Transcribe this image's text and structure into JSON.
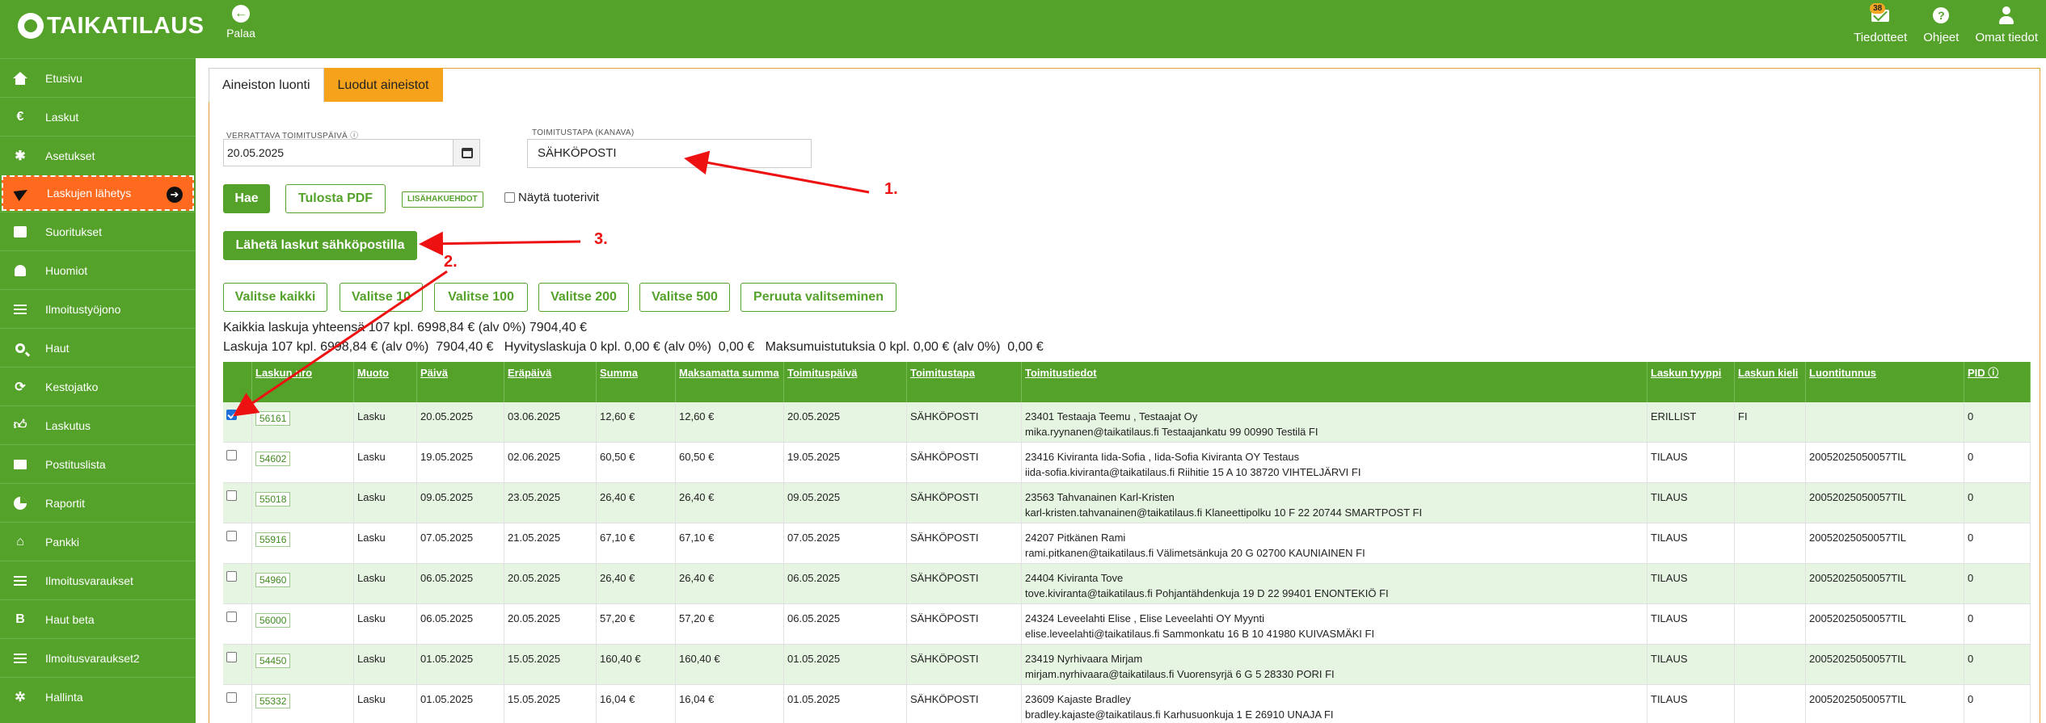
{
  "brand": {
    "logo_text": "TAIKATILAUS",
    "accent": "#55a22b",
    "tab_active": "#f7a21b",
    "sidebar_active": "#ff6a1f"
  },
  "topbar": {
    "back_label": "Palaa",
    "notifications": {
      "label": "Tiedotteet",
      "count": "38"
    },
    "help_label": "Ohjeet",
    "profile_label": "Omat tiedot"
  },
  "sidebar": {
    "items": [
      {
        "label": "Etusivu",
        "icon": "home-icon"
      },
      {
        "label": "Laskut",
        "icon": "euro-icon"
      },
      {
        "label": "Asetukset",
        "icon": "gear-icon"
      },
      {
        "label": "Laskujen lähetys",
        "icon": "paper-plane-icon",
        "active": true
      },
      {
        "label": "Suoritukset",
        "icon": "book-icon"
      },
      {
        "label": "Huomiot",
        "icon": "bell-icon"
      },
      {
        "label": "Ilmoitustyöjono",
        "icon": "list-icon"
      },
      {
        "label": "Haut",
        "icon": "search-icon"
      },
      {
        "label": "Kestojatko",
        "icon": "refresh-icon"
      },
      {
        "label": "Laskutus",
        "icon": "thumbs-up-icon"
      },
      {
        "label": "Postituslista",
        "icon": "envelope-icon"
      },
      {
        "label": "Raportit",
        "icon": "pie-chart-icon"
      },
      {
        "label": "Pankki",
        "icon": "bank-icon"
      },
      {
        "label": "Ilmoitusvaraukset",
        "icon": "list-icon"
      },
      {
        "label": "Haut beta",
        "icon": "bold-b-icon"
      },
      {
        "label": "Ilmoitusvaraukset2",
        "icon": "list-icon"
      },
      {
        "label": "Hallinta",
        "icon": "gears-icon"
      }
    ]
  },
  "tabs": [
    {
      "label": "Aineiston luonti"
    },
    {
      "label": "Luodut aineistot"
    }
  ],
  "form": {
    "date_label": "VERRATTAVA TOIMITUSPÄIVÄ",
    "date_value": "20.05.2025",
    "channel_label": "TOIMITUSTAPA (KANAVA)",
    "channel_value": "SÄHKÖPOSTI",
    "search_button": "Hae",
    "pdf_button": "Tulosta PDF",
    "extra_button": "LISÄHAKUEHDOT",
    "show_rows_label": "Näytä tuoterivit",
    "send_button": "Lähetä laskut sähköpostilla"
  },
  "select_buttons": [
    "Valitse kaikki",
    "Valitse 10",
    "Valitse 100",
    "Valitse 200",
    "Valitse 500",
    "Peruuta valitseminen"
  ],
  "summary": {
    "line1": "Kaikkia laskuja yhteensä 107 kpl. 6998,84 € (alv 0%)  7904,40 €",
    "line2": "Laskuja 107 kpl. 6998,84 € (alv 0%)  7904,40 €   Hyvityslaskuja 0 kpl. 0,00 € (alv 0%)  0,00 €   Maksumuistutuksia 0 kpl. 0,00 € (alv 0%)  0,00 €"
  },
  "table": {
    "headers": [
      "",
      "Laskun nro",
      "Muoto",
      "Päivä",
      "Eräpäivä",
      "Summa",
      "Maksamatta summa",
      "Toimituspäivä",
      "Toimitustapa",
      "Toimitustiedot",
      "Laskun tyyppi",
      "Laskun kieli",
      "Luontitunnus",
      "PID"
    ],
    "rows": [
      {
        "checked": true,
        "nro": "56161",
        "muoto": "Lasku",
        "paiva": "20.05.2025",
        "erapaiva": "03.06.2025",
        "summa": "12,60 €",
        "maksamatta": "12,60 €",
        "toimituspaiva": "20.05.2025",
        "toimitustapa": "SÄHKÖPOSTI",
        "tiedot1": "23401 Testaaja Teemu , Testaajat Oy",
        "tiedot2": "mika.ryynanen@taikatilaus.fi Testaajankatu 99 00990 Testilä FI",
        "tyyppi": "ERILLIST",
        "kieli": "FI",
        "luontitunnus": "",
        "pid": "0"
      },
      {
        "checked": false,
        "nro": "54602",
        "muoto": "Lasku",
        "paiva": "19.05.2025",
        "erapaiva": "02.06.2025",
        "summa": "60,50 €",
        "maksamatta": "60,50 €",
        "toimituspaiva": "19.05.2025",
        "toimitustapa": "SÄHKÖPOSTI",
        "tiedot1": "23416 Kiviranta Iida-Sofia , Iida-Sofia Kiviranta OY Testaus",
        "tiedot2": "iida-sofia.kiviranta@taikatilaus.fi Riihitie 15 A 10 38720 VIHTELJÄRVI FI",
        "tyyppi": "TILAUS",
        "kieli": "",
        "luontitunnus": "20052025050057TIL",
        "pid": "0"
      },
      {
        "checked": false,
        "nro": "55018",
        "muoto": "Lasku",
        "paiva": "09.05.2025",
        "erapaiva": "23.05.2025",
        "summa": "26,40 €",
        "maksamatta": "26,40 €",
        "toimituspaiva": "09.05.2025",
        "toimitustapa": "SÄHKÖPOSTI",
        "tiedot1": "23563 Tahvanainen Karl-Kristen",
        "tiedot2": "karl-kristen.tahvanainen@taikatilaus.fi Klaneettipolku 10 F 22 20744 SMARTPOST FI",
        "tyyppi": "TILAUS",
        "kieli": "",
        "luontitunnus": "20052025050057TIL",
        "pid": "0"
      },
      {
        "checked": false,
        "nro": "55916",
        "muoto": "Lasku",
        "paiva": "07.05.2025",
        "erapaiva": "21.05.2025",
        "summa": "67,10 €",
        "maksamatta": "67,10 €",
        "toimituspaiva": "07.05.2025",
        "toimitustapa": "SÄHKÖPOSTI",
        "tiedot1": "24207 Pitkänen Rami",
        "tiedot2": "rami.pitkanen@taikatilaus.fi Välimetsänkuja 20 G 02700 KAUNIAINEN FI",
        "tyyppi": "TILAUS",
        "kieli": "",
        "luontitunnus": "20052025050057TIL",
        "pid": "0"
      },
      {
        "checked": false,
        "nro": "54960",
        "muoto": "Lasku",
        "paiva": "06.05.2025",
        "erapaiva": "20.05.2025",
        "summa": "26,40 €",
        "maksamatta": "26,40 €",
        "toimituspaiva": "06.05.2025",
        "toimitustapa": "SÄHKÖPOSTI",
        "tiedot1": "24404 Kiviranta Tove",
        "tiedot2": "tove.kiviranta@taikatilaus.fi Pohjantähdenkuja 19 D 22 99401 ENONTEKIÖ FI",
        "tyyppi": "TILAUS",
        "kieli": "",
        "luontitunnus": "20052025050057TIL",
        "pid": "0"
      },
      {
        "checked": false,
        "nro": "56000",
        "muoto": "Lasku",
        "paiva": "06.05.2025",
        "erapaiva": "20.05.2025",
        "summa": "57,20 €",
        "maksamatta": "57,20 €",
        "toimituspaiva": "06.05.2025",
        "toimitustapa": "SÄHKÖPOSTI",
        "tiedot1": "24324 Leveelahti Elise , Elise Leveelahti OY Myynti",
        "tiedot2": "elise.leveelahti@taikatilaus.fi Sammonkatu 16 B 10 41980 KUIVASMÄKI FI",
        "tyyppi": "TILAUS",
        "kieli": "",
        "luontitunnus": "20052025050057TIL",
        "pid": "0"
      },
      {
        "checked": false,
        "nro": "54450",
        "muoto": "Lasku",
        "paiva": "01.05.2025",
        "erapaiva": "15.05.2025",
        "summa": "160,40 €",
        "maksamatta": "160,40 €",
        "toimituspaiva": "01.05.2025",
        "toimitustapa": "SÄHKÖPOSTI",
        "tiedot1": "23419 Nyrhivaara Mirjam",
        "tiedot2": "mirjam.nyrhivaara@taikatilaus.fi Vuorensyrjä 6 G 5 28330 PORI FI",
        "tyyppi": "TILAUS",
        "kieli": "",
        "luontitunnus": "20052025050057TIL",
        "pid": "0"
      },
      {
        "checked": false,
        "nro": "55332",
        "muoto": "Lasku",
        "paiva": "01.05.2025",
        "erapaiva": "15.05.2025",
        "summa": "16,04 €",
        "maksamatta": "16,04 €",
        "toimituspaiva": "01.05.2025",
        "toimitustapa": "SÄHKÖPOSTI",
        "tiedot1": "23609 Kajaste Bradley",
        "tiedot2": "bradley.kajaste@taikatilaus.fi Karhusuonkuja 1 E 26910 UNAJA FI",
        "tyyppi": "TILAUS",
        "kieli": "",
        "luontitunnus": "20052025050057TIL",
        "pid": "0"
      }
    ]
  },
  "annotations": [
    "1.",
    "2.",
    "3."
  ]
}
